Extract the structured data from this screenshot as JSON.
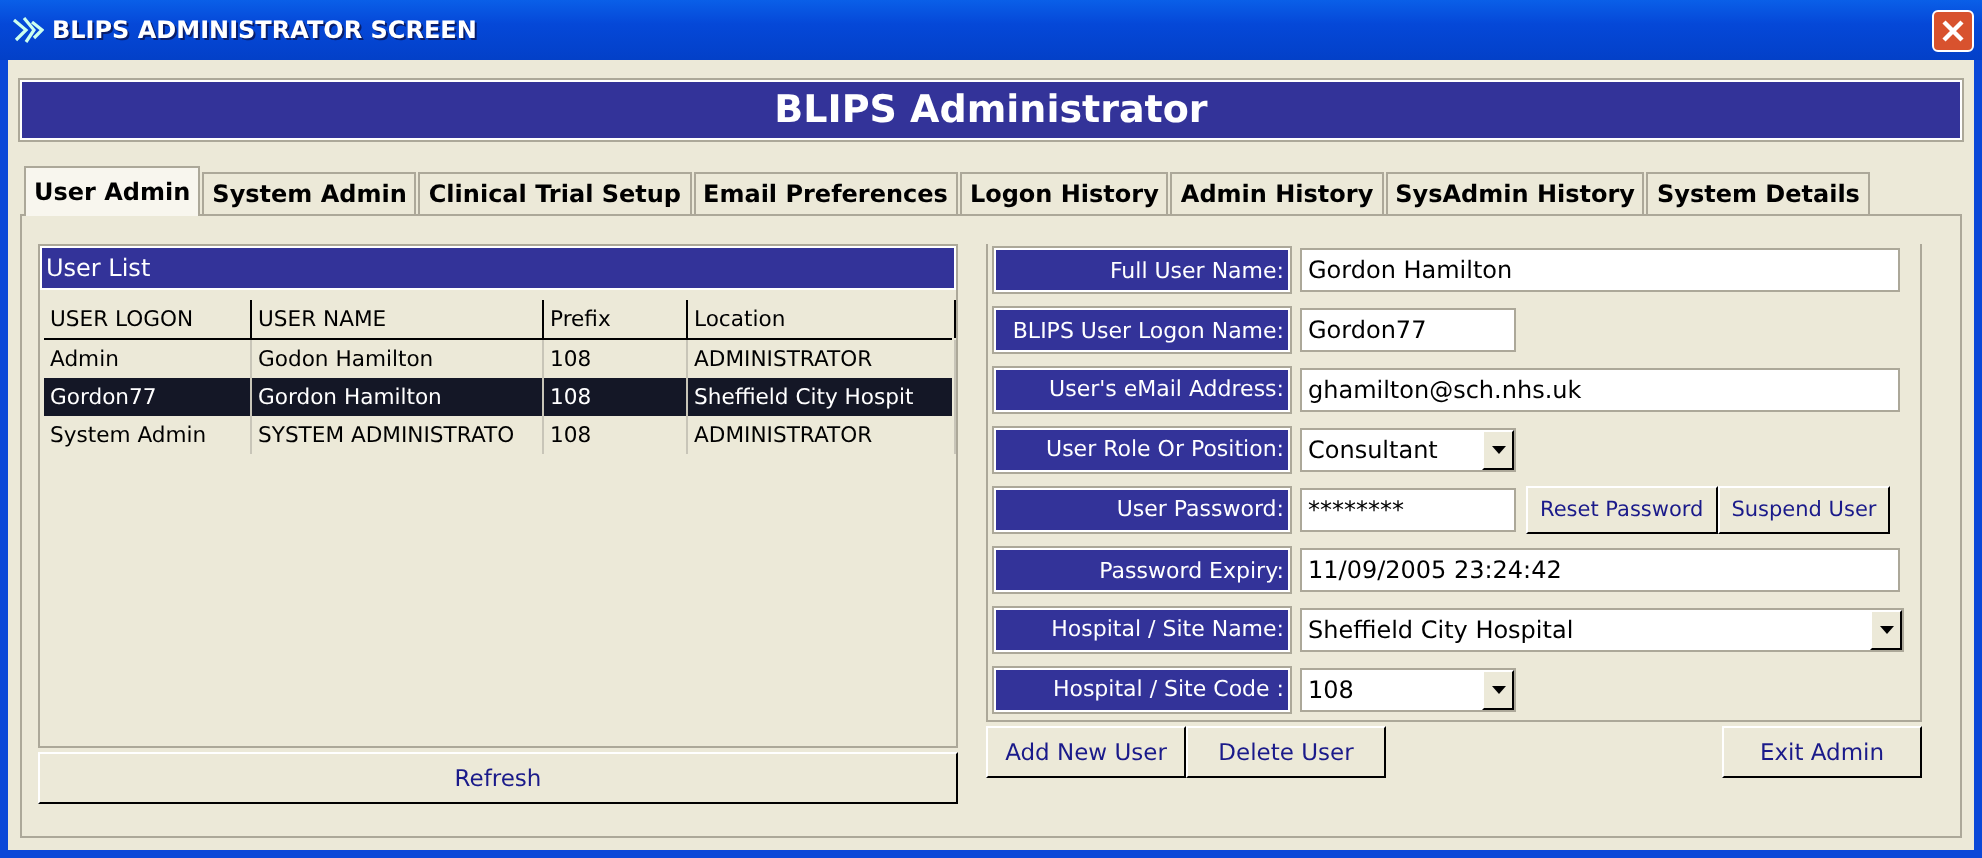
{
  "window": {
    "title": "BLIPS ADMINISTRATOR SCREEN"
  },
  "banner": "BLIPS Administrator",
  "tabs": [
    {
      "label": "User Admin",
      "selected": true
    },
    {
      "label": "System Admin",
      "selected": false
    },
    {
      "label": "Clinical Trial Setup",
      "selected": false
    },
    {
      "label": "Email Preferences",
      "selected": false
    },
    {
      "label": "Logon History",
      "selected": false
    },
    {
      "label": "Admin History",
      "selected": false
    },
    {
      "label": "SysAdmin History",
      "selected": false
    },
    {
      "label": "System Details",
      "selected": false
    }
  ],
  "user_list": {
    "title": "User List",
    "columns": [
      "USER LOGON",
      "USER NAME",
      "Prefix",
      "Location"
    ],
    "rows": [
      {
        "cells": [
          "Admin",
          "Godon Hamilton",
          "108",
          "ADMINISTRATOR"
        ],
        "selected": false
      },
      {
        "cells": [
          "Gordon77",
          "Gordon Hamilton",
          "108",
          "Sheffield City Hospit"
        ],
        "selected": true
      },
      {
        "cells": [
          "System Admin",
          "SYSTEM ADMINISTRATO",
          "108",
          "ADMINISTRATOR"
        ],
        "selected": false
      }
    ],
    "refresh_button": "Refresh"
  },
  "form": [
    {
      "label": "Full User Name:",
      "value": "Gordon Hamilton",
      "kind": "text"
    },
    {
      "label": "BLIPS User Logon Name:",
      "value": "Gordon77",
      "kind": "short-text"
    },
    {
      "label": "User's eMail Address:",
      "value": "ghamilton@sch.nhs.uk",
      "kind": "text"
    },
    {
      "label": "User Role Or Position:",
      "value": "Consultant",
      "kind": "short-combo"
    },
    {
      "label": "User Password:",
      "value": "********",
      "kind": "password",
      "buttons": [
        "Reset Password",
        "Suspend User"
      ]
    },
    {
      "label": "Password Expiry:",
      "value": "11/09/2005 23:24:42",
      "kind": "text"
    },
    {
      "label": "Hospital / Site Name:",
      "value": "Sheffield City Hospital",
      "kind": "combo"
    },
    {
      "label": "Hospital / Site Code :",
      "value": "108",
      "kind": "short-combo"
    }
  ],
  "buttons": [
    "Add New User",
    "Delete User"
  ],
  "exit_button": "Exit Admin"
}
